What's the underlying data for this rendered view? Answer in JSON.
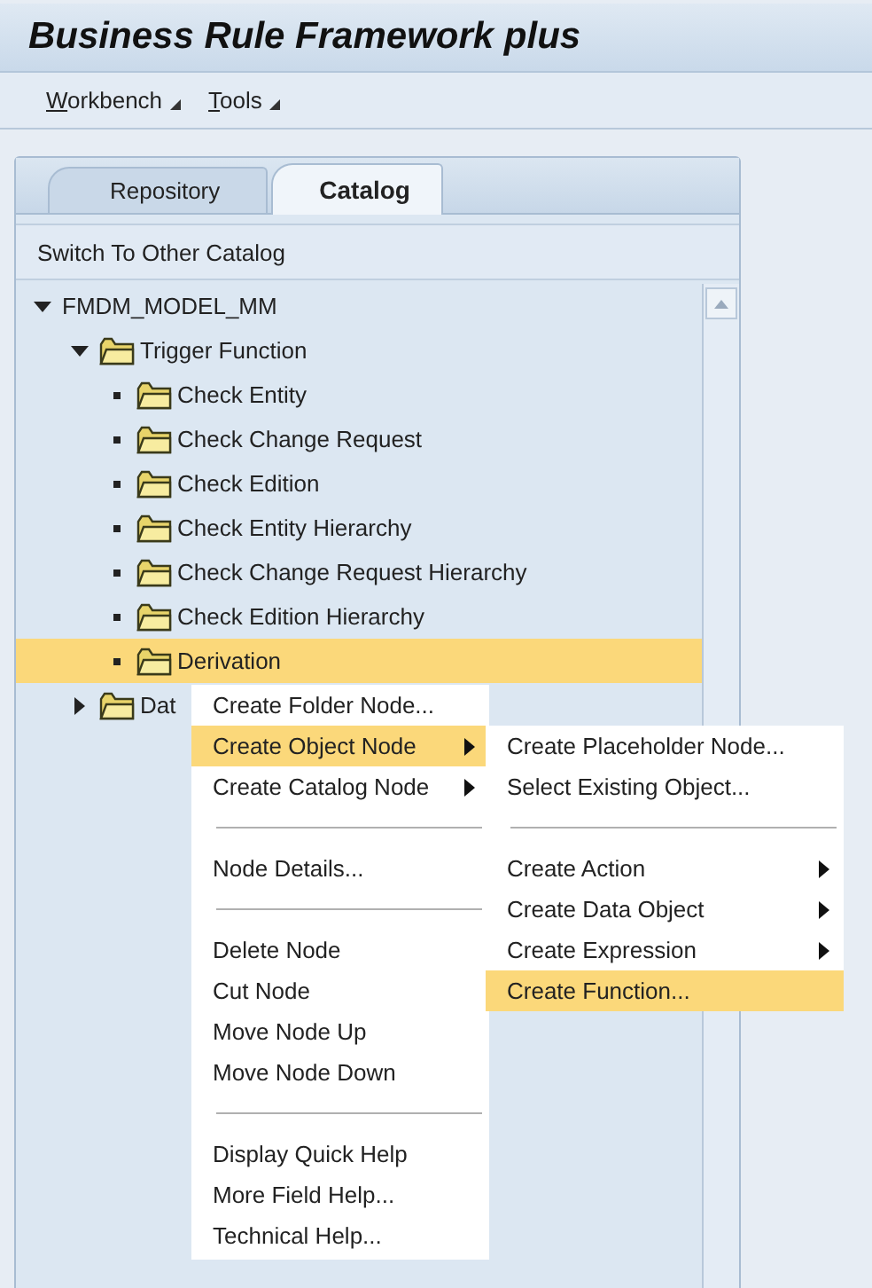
{
  "window": {
    "title": "Business Rule Framework plus"
  },
  "menu_bar": [
    {
      "label": "Workbench"
    },
    {
      "label": "Tools"
    }
  ],
  "tabs": [
    {
      "label": "Repository",
      "selected": false
    },
    {
      "label": "Catalog",
      "selected": true
    }
  ],
  "catalog_switch": "Switch To Other Catalog",
  "tree": [
    {
      "label": "FMDM_MODEL_MM",
      "kind": "root",
      "expanded": true,
      "selected": false,
      "children": [
        {
          "label": "Trigger Function",
          "kind": "folder",
          "expanded": true,
          "selected": false,
          "children": [
            {
              "label": "Check Entity",
              "kind": "folder",
              "selected": false
            },
            {
              "label": "Check Change Request",
              "kind": "folder",
              "selected": false
            },
            {
              "label": "Check Edition",
              "kind": "folder",
              "selected": false
            },
            {
              "label": "Check Entity Hierarchy",
              "kind": "folder",
              "selected": false
            },
            {
              "label": "Check Change Request Hierarchy",
              "kind": "folder",
              "selected": false
            },
            {
              "label": "Check Edition Hierarchy",
              "kind": "folder",
              "selected": false
            },
            {
              "label": "Derivation",
              "kind": "folder",
              "selected": true
            }
          ]
        },
        {
          "label": "Dat",
          "kind": "folder",
          "expanded": false,
          "selected": false
        }
      ]
    }
  ],
  "context_menu": [
    {
      "kind": "item",
      "label": "Create Folder Node...",
      "submenu": false,
      "selected": false
    },
    {
      "kind": "item",
      "label": "Create Object Node",
      "submenu": true,
      "selected": true
    },
    {
      "kind": "item",
      "label": "Create Catalog Node",
      "submenu": true,
      "selected": false
    },
    {
      "kind": "separator"
    },
    {
      "kind": "item",
      "label": "Node Details...",
      "submenu": false,
      "selected": false
    },
    {
      "kind": "separator"
    },
    {
      "kind": "item",
      "label": "Delete Node",
      "submenu": false,
      "selected": false
    },
    {
      "kind": "item",
      "label": "Cut Node",
      "submenu": false,
      "selected": false
    },
    {
      "kind": "item",
      "label": "Move Node Up",
      "submenu": false,
      "selected": false
    },
    {
      "kind": "item",
      "label": "Move Node Down",
      "submenu": false,
      "selected": false
    },
    {
      "kind": "separator"
    },
    {
      "kind": "item",
      "label": "Display Quick Help",
      "submenu": false,
      "selected": false
    },
    {
      "kind": "item",
      "label": "More Field Help...",
      "submenu": false,
      "selected": false
    },
    {
      "kind": "item",
      "label": "Technical Help...",
      "submenu": false,
      "selected": false
    }
  ],
  "submenu": [
    {
      "kind": "item",
      "label": "Create Placeholder Node...",
      "submenu": false,
      "selected": false
    },
    {
      "kind": "item",
      "label": "Select Existing Object...",
      "submenu": false,
      "selected": false
    },
    {
      "kind": "separator"
    },
    {
      "kind": "item",
      "label": "Create Action",
      "submenu": true,
      "selected": false
    },
    {
      "kind": "item",
      "label": "Create Data Object",
      "submenu": true,
      "selected": false
    },
    {
      "kind": "item",
      "label": "Create Expression",
      "submenu": true,
      "selected": false
    },
    {
      "kind": "item",
      "label": "Create Function...",
      "submenu": false,
      "selected": true
    }
  ]
}
